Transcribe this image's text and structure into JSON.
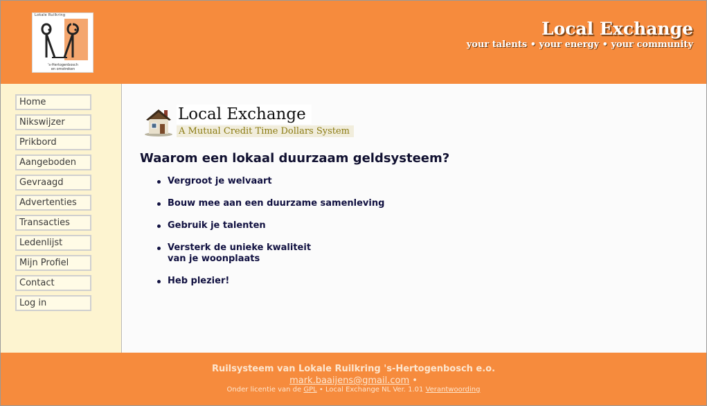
{
  "header": {
    "logo": {
      "top_text": "Lokale Ruilkring",
      "mark": "RR",
      "bottom_text_1": "'s-Hertogenbosch",
      "bottom_text_2": "en omstreken"
    },
    "site_title": "Local Exchange",
    "tagline": "your talents • your energy • your community"
  },
  "sidebar": {
    "items": [
      {
        "label": "Home"
      },
      {
        "label": "Nikswijzer"
      },
      {
        "label": "Prikbord"
      },
      {
        "label": "Aangeboden"
      },
      {
        "label": "Gevraagd"
      },
      {
        "label": "Advertenties"
      },
      {
        "label": "Transacties"
      },
      {
        "label": "Ledenlijst"
      },
      {
        "label": "Mijn Profiel"
      },
      {
        "label": "Contact"
      },
      {
        "label": "Log in"
      }
    ]
  },
  "main": {
    "banner": {
      "icon": "house-icon",
      "title": "Local Exchange",
      "subtitle": "A Mutual Credit Time Dollars System"
    },
    "heading": "Waarom een lokaal duurzaam geldsysteem?",
    "bullets": [
      {
        "line1": "Vergroot je welvaart",
        "line2": ""
      },
      {
        "line1": "Bouw mee aan een duurzame samenleving",
        "line2": ""
      },
      {
        "line1": "Gebruik je talenten",
        "line2": ""
      },
      {
        "line1": "Versterk de unieke kwaliteit",
        "line2": "van je woonplaats"
      },
      {
        "line1": "Heb plezier!",
        "line2": ""
      }
    ]
  },
  "footer": {
    "line1": "Ruilsysteem van Lokale Ruilkring 's-Hertogenbosch e.o.",
    "email": "mark.baaijens@gmail.com",
    "email_separator": "•",
    "license_prefix": "Onder licentie van de",
    "license_link": "GPL",
    "version_text": "• Local Exchange NL Ver. 1.01",
    "accountability_link": "Verantwoording"
  },
  "colors": {
    "accent": "#f68b3d",
    "sidebar_bg": "#fdf4d0",
    "text_dark": "#101040"
  }
}
